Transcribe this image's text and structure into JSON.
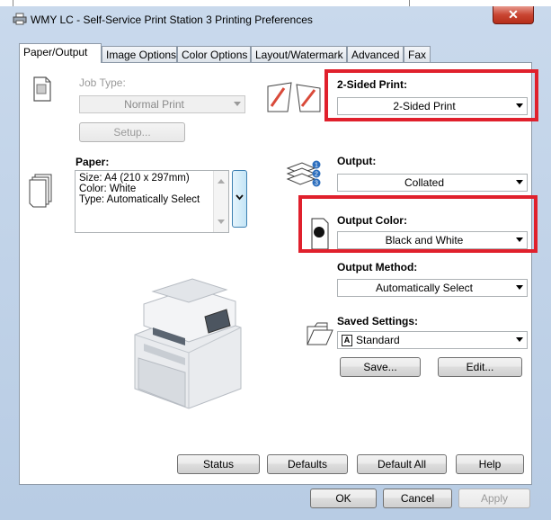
{
  "window": {
    "title": "WMY LC - Self-Service Print Station 3 Printing Preferences",
    "close_glyph": "✕"
  },
  "tabs": [
    {
      "label": "Paper/Output",
      "active": true
    },
    {
      "label": "Image Options",
      "active": false
    },
    {
      "label": "Color Options",
      "active": false
    },
    {
      "label": "Layout/Watermark",
      "active": false
    },
    {
      "label": "Advanced",
      "active": false
    },
    {
      "label": "Fax",
      "active": false
    }
  ],
  "job_type": {
    "label": "Job Type:",
    "value": "Normal Print",
    "setup_button": "Setup..."
  },
  "paper": {
    "label": "Paper:",
    "lines": [
      "Size: A4 (210 x 297mm)",
      "Color: White",
      "Type: Automatically Select"
    ]
  },
  "two_sided": {
    "label": "2-Sided Print:",
    "value": "2-Sided Print"
  },
  "output": {
    "label": "Output:",
    "value": "Collated",
    "badges": [
      "1",
      "2",
      "3"
    ]
  },
  "output_color": {
    "label": "Output Color:",
    "value": "Black and White"
  },
  "output_method": {
    "label": "Output Method:",
    "value": "Automatically Select"
  },
  "saved_settings": {
    "label": "Saved Settings:",
    "value": "Standard",
    "value_prefix": "A",
    "save_button": "Save...",
    "edit_button": "Edit..."
  },
  "panel_buttons": {
    "status": "Status",
    "defaults": "Defaults",
    "default_all": "Default All",
    "help": "Help"
  },
  "dialog_buttons": {
    "ok": "OK",
    "cancel": "Cancel",
    "apply": "Apply"
  },
  "colors": {
    "highlight": "#e0202c",
    "frame": "#b8cce4",
    "close": "#c94532"
  }
}
